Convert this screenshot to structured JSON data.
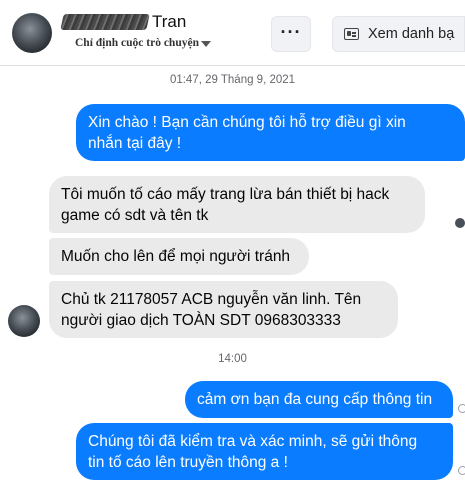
{
  "header": {
    "contact_name": "Tran",
    "subtitle": "Chỉ định cuộc trò chuyện",
    "more_label": "···",
    "view_contact_label": "Xem danh bạ"
  },
  "conversation": {
    "timestamp_1": "01:47, 29 Tháng 9, 2021",
    "timestamp_2": "14:00",
    "messages": [
      {
        "from": "page",
        "lines": [
          "Xin chào ! Bạn cần chúng tôi hỗ trợ điều gì xin",
          "nhắn tại đây !"
        ]
      },
      {
        "from": "user",
        "lines": [
          "Tôi muốn tố cáo mấy trang lừa bán thiết bị hack",
          "game có sdt và tên tk"
        ]
      },
      {
        "from": "user",
        "lines": [
          "Muốn cho lên để mọi người tránh"
        ]
      },
      {
        "from": "user",
        "lines": [
          "Chủ tk 21178057 ACB nguyễn văn linh. Tên",
          "người giao dịch TOÀN SDT 0968303333"
        ]
      },
      {
        "from": "page",
        "lines": [
          "cảm ơn bạn đa cung cấp thông tin"
        ]
      },
      {
        "from": "page",
        "lines": [
          "Chúng tôi đã kiểm tra và xác minh, sẽ gửi thông",
          "tin tố cáo lên truyền thông a !"
        ]
      }
    ]
  },
  "colors": {
    "outgoing_bubble": "#0a7cff",
    "incoming_bubble": "#eaeaea"
  }
}
